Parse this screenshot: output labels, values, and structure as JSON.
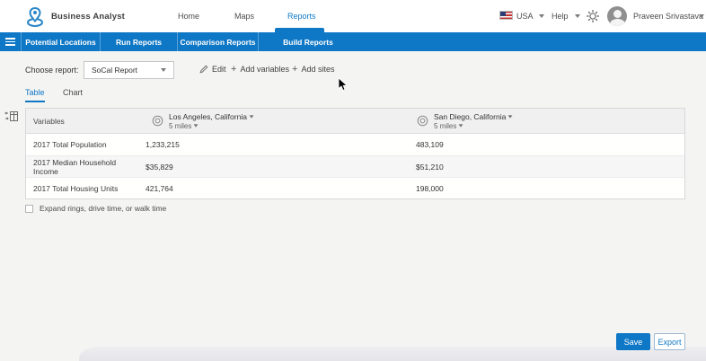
{
  "colors": {
    "accent": "#0e77c6",
    "subnav_bg": "#0e77c6"
  },
  "header": {
    "brand": "Business Analyst",
    "nav": [
      {
        "label": "Home"
      },
      {
        "label": "Maps"
      },
      {
        "label": "Reports"
      }
    ],
    "country": "USA",
    "help_label": "Help",
    "user_name": "Praveen Srivastava"
  },
  "subnav": {
    "items": [
      {
        "label": "Potential Locations"
      },
      {
        "label": "Run Reports"
      },
      {
        "label": "Comparison Reports"
      },
      {
        "label": "Build Reports"
      }
    ]
  },
  "toolbar": {
    "choose_report_label": "Choose report:",
    "selected_report": "SoCal Report",
    "edit_label": "Edit",
    "plus_glyph": "+",
    "add_variables_label": "Add variables",
    "add_sites_label": "Add sites"
  },
  "tabs": {
    "table_label": "Table",
    "chart_label": "Chart"
  },
  "comparison_table": {
    "variables_header": "Variables",
    "sites": [
      {
        "name": "Los Angeles, California",
        "ring": "5 miles"
      },
      {
        "name": "San Diego, California",
        "ring": "5 miles"
      }
    ],
    "rows": [
      {
        "variable": "2017 Total Population",
        "v0": "1,233,215",
        "v1": "483,109"
      },
      {
        "variable": "2017 Median Household Income",
        "v0": "$35,829",
        "v1": "$51,210"
      },
      {
        "variable": "2017 Total Housing Units",
        "v0": "421,764",
        "v1": "198,000"
      }
    ]
  },
  "options": {
    "expand_label": "Expand rings, drive time, or walk time"
  },
  "footer": {
    "save_label": "Save",
    "export_label": "Export"
  }
}
